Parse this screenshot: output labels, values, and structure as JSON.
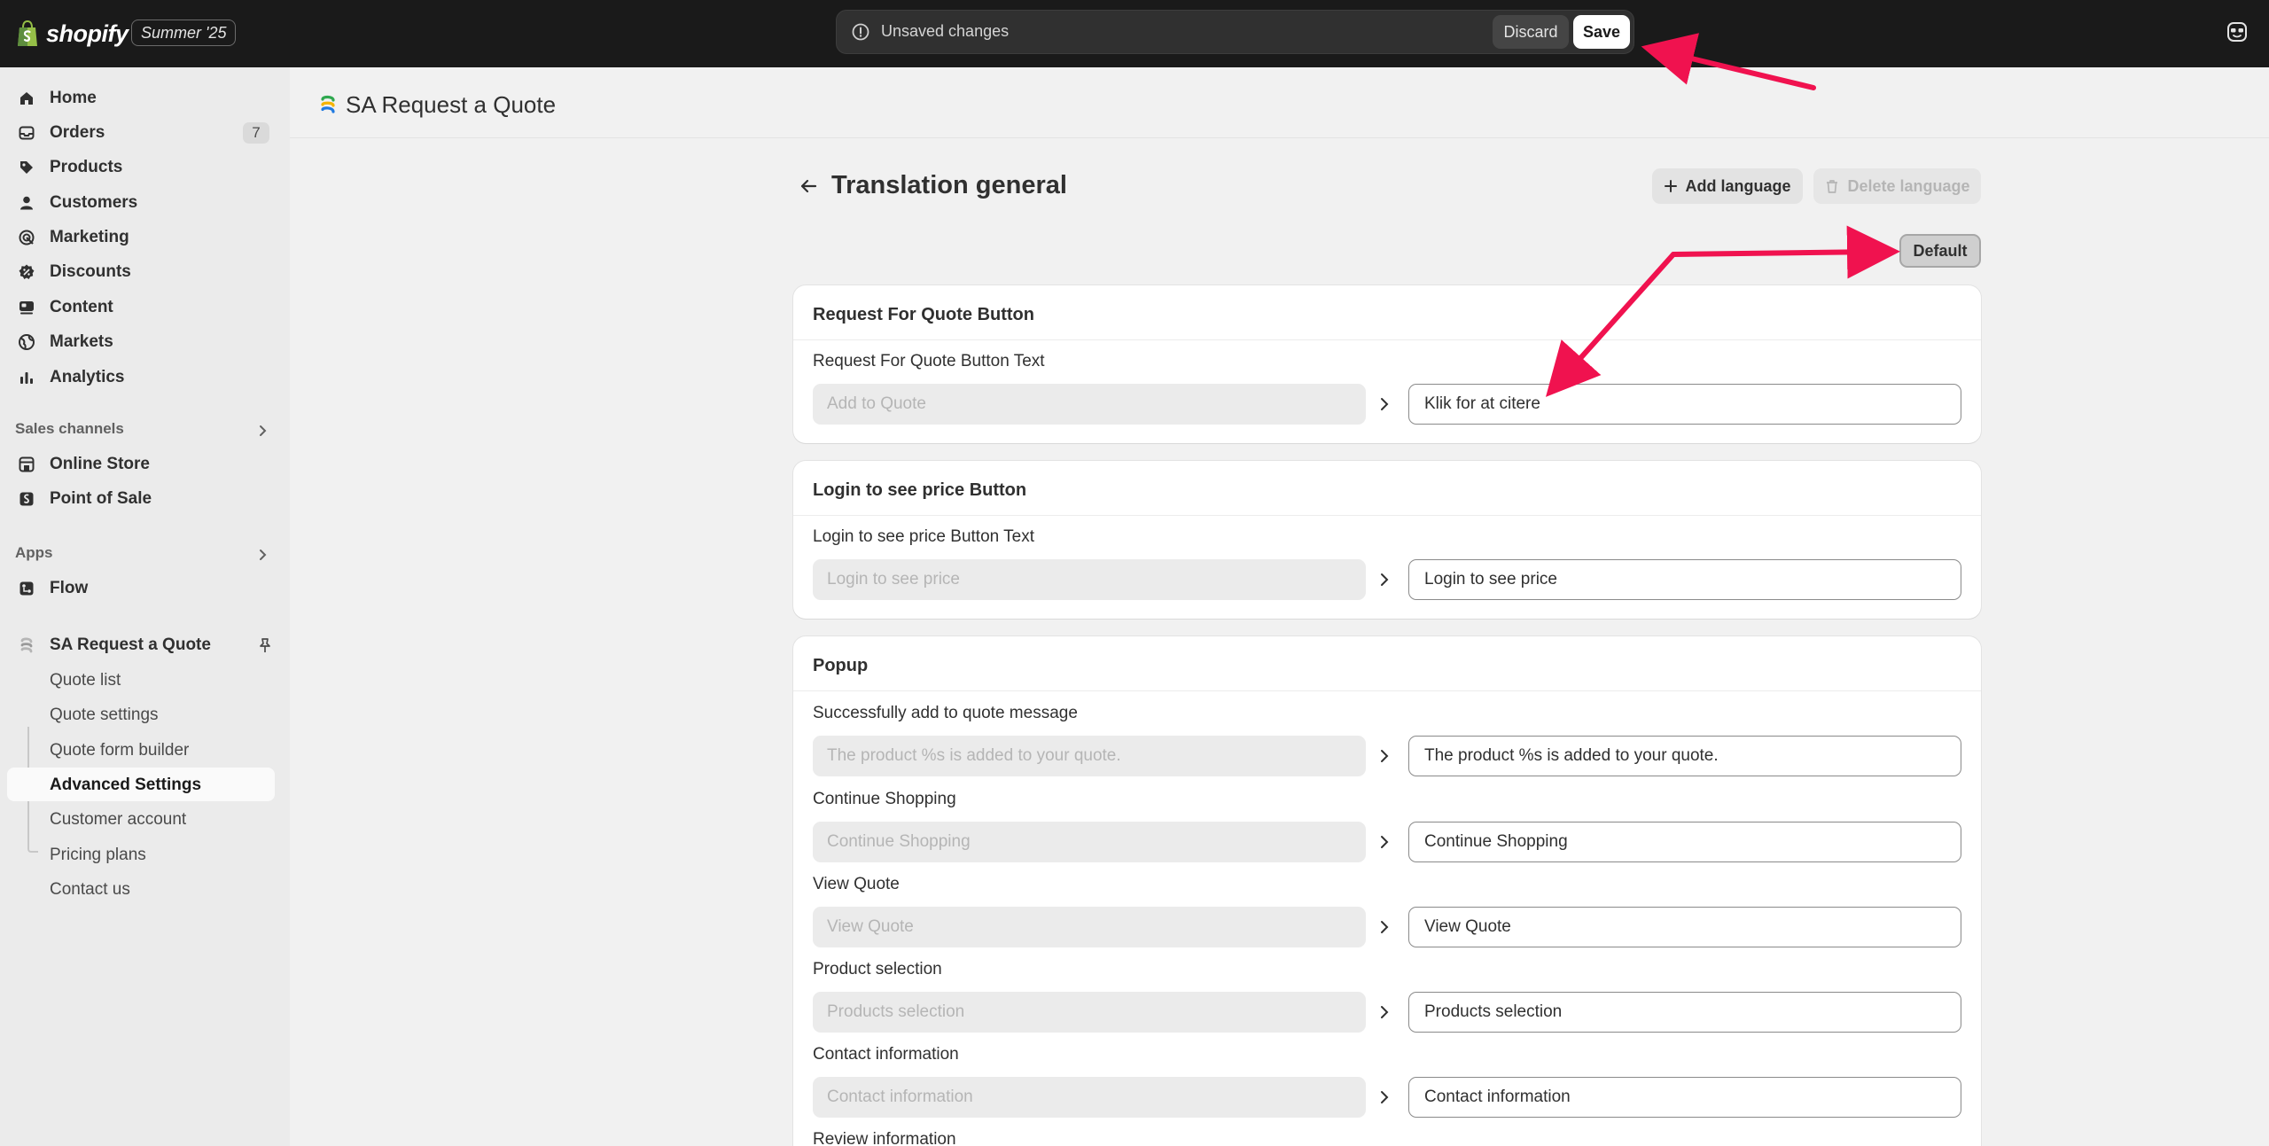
{
  "topbar": {
    "brand": "shopify",
    "edition": "Summer '25",
    "unsaved_text": "Unsaved changes",
    "discard_label": "Discard",
    "save_label": "Save"
  },
  "sidebar": {
    "items": [
      {
        "label": "Home",
        "icon": "home-icon"
      },
      {
        "label": "Orders",
        "icon": "inbox-icon",
        "badge": "7"
      },
      {
        "label": "Products",
        "icon": "tag-icon"
      },
      {
        "label": "Customers",
        "icon": "person-icon"
      },
      {
        "label": "Marketing",
        "icon": "target-icon"
      },
      {
        "label": "Discounts",
        "icon": "discount-icon"
      },
      {
        "label": "Content",
        "icon": "content-icon"
      },
      {
        "label": "Markets",
        "icon": "globe-icon"
      },
      {
        "label": "Analytics",
        "icon": "bar-chart-icon"
      }
    ],
    "sales_channels_label": "Sales channels",
    "sales_channels": [
      {
        "label": "Online Store",
        "icon": "store-icon"
      },
      {
        "label": "Point of Sale",
        "icon": "pos-icon"
      }
    ],
    "apps_label": "Apps",
    "apps": [
      {
        "label": "Flow",
        "icon": "flow-icon"
      }
    ],
    "app_name": "SA Request a Quote",
    "app_subitems": [
      "Quote list",
      "Quote settings",
      "Quote form builder",
      "Advanced Settings",
      "Customer account",
      "Pricing plans",
      "Contact us"
    ]
  },
  "app_header": {
    "title": "SA Request a Quote"
  },
  "page": {
    "title": "Translation general",
    "add_language_label": "Add language",
    "delete_language_label": "Delete language",
    "default_label": "Default"
  },
  "cards": [
    {
      "title": "Request For Quote Button",
      "fields": [
        {
          "label": "Request For Quote Button Text",
          "default_placeholder": "Add to Quote",
          "value": "Klik for at citere"
        }
      ]
    },
    {
      "title": "Login to see price Button",
      "fields": [
        {
          "label": "Login to see price Button Text",
          "default_placeholder": "Login to see price",
          "value": "Login to see price"
        }
      ]
    },
    {
      "title": "Popup",
      "fields": [
        {
          "label": "Successfully add to quote message",
          "default_placeholder": "The product %s is added to your quote.",
          "value": "The product %s is added to your quote."
        },
        {
          "label": "Continue Shopping",
          "default_placeholder": "Continue Shopping",
          "value": "Continue Shopping"
        },
        {
          "label": "View Quote",
          "default_placeholder": "View Quote",
          "value": "View Quote"
        },
        {
          "label": "Product selection",
          "default_placeholder": "Products selection",
          "value": "Products selection"
        },
        {
          "label": "Contact information",
          "default_placeholder": "Contact information",
          "value": "Contact information"
        },
        {
          "label": "Review information"
        }
      ]
    }
  ],
  "colors": {
    "topbar_bg": "#1a1a1a",
    "sidebar_bg": "#ebebeb",
    "page_bg": "#f1f1f1",
    "annotation_arrow": "#f0124f"
  }
}
